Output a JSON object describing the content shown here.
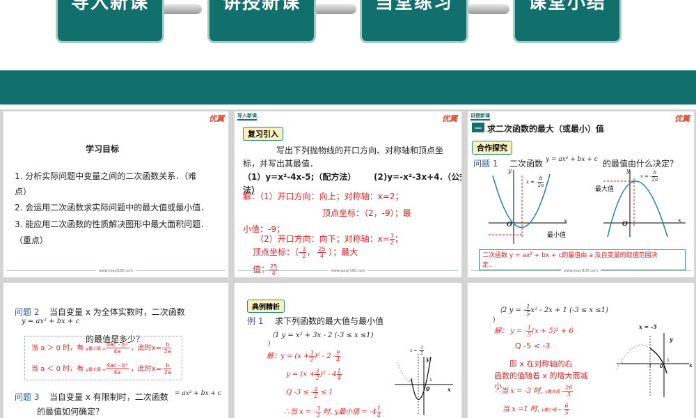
{
  "nav_tabs": [
    "导入新课",
    "讲授新课",
    "当堂练习",
    "课堂小结"
  ],
  "brand": "优翼",
  "website": "www.youyi100.com",
  "colors": {
    "primary": "#12706c",
    "red": "#e02020",
    "blue": "#2b55a4"
  },
  "panel1": {
    "heading": "学习目标",
    "goals": [
      "1. 分析实际问题中变量之间的二次函数关系．（难",
      "点）",
      "2. 会运用二次函数求实际问题中的最大值或最小值．",
      "3. 能应用二次函数的性质解决图形中最大面积问题．",
      "（重点）"
    ]
  },
  "panel2": {
    "header": "导入新课",
    "tag": "复习引入",
    "prompt1": "写出下列抛物线的开口方向、对称轴和顶点坐",
    "prompt2": "标，并写出其最值．",
    "q1": "（1）y=x²-4x-5;（配方法）",
    "q2": "(2)y=-x²-3x+4.（公式",
    "q2b": "法）",
    "a1": "解：（1）开口方向：向上；对称轴：x=2；",
    "a2": "顶点坐标：（2，-9）；最",
    "a3": "小值：-9；",
    "a4": "（2）开口方向：向下；对称轴：x=",
    "a4_num": "3",
    "a4_den": "2",
    "a4_tail": "；",
    "a5": "顶点坐标：（-",
    "a5_num1": "3",
    "a5_den1": "2",
    "a5_sep": "，",
    "a5_num2": "25",
    "a5_den2": "4",
    "a5_tail": "）；最大",
    "a6": "值：",
    "a6_num": "25",
    "a6_den": "4"
  },
  "panel3": {
    "header": "讲授新课",
    "section_num": "一",
    "title": "求二次函数的最大（或最小）值",
    "tag": "合作探究",
    "question_label": "问题 1",
    "question": "二次函数",
    "formula": "y = ax² + bx + c",
    "question_tail": "的最值由什么决定？",
    "axis_x": "x",
    "axis_y": "y",
    "origin": "O",
    "sym_left": "x = -",
    "sym_b": "b",
    "sym_2a": "2a",
    "label_min": "最小值",
    "label_max": "最大值",
    "conclusion1": "二次函数 y = ax² + bx + c的最值由 a 及自变量的取值范围决",
    "conclusion2": "定．"
  },
  "panel4": {
    "q2_label": "问题 2",
    "q2": "当自变量 x 为全体实数时，二次函数",
    "q2_formula": "y = ax² + bx + c",
    "q2_tail": "的最值是多少？",
    "case1": "当 a ＞ 0 时，有",
    "case1_sub": "y最小值 =",
    "case1_num": "4ac - b²",
    "case1_den": "4a",
    "case1_tail": "，此时x=-",
    "case1_b": "b",
    "case1_2a": "2a",
    "case2": "当 a ＜ 0 时，有",
    "case2_sub": "y最大值 =",
    "case2_num": "4ac - b²",
    "case2_den": "4a",
    "case2_tail": "，此时x=-",
    "case2_b": "b",
    "case2_2a": "2a",
    "q3_label": "问题 3",
    "q3": "当自变量 x 有限制时，二次函数",
    "q3_formula": "= ax² + bx + c",
    "q3_tail": "的最值如何确定？"
  },
  "panel5": {
    "tag": "典例精析",
    "ex_label": "例 1",
    "ex": "求下列函数的最大值与最小值",
    "item1": "（1 y = x² + 3x - 2 (-3 ≤ x ≤1)",
    "item1b": "）",
    "s1": "解：y = (x +",
    "s1b": ")² - 2 -",
    "s2": "y = (x +",
    "s2b": ")² - 4",
    "s3": "Q -3 ≤ -",
    "s3b": "≤ 1",
    "s4": "∴当 x = -",
    "s4b": "时, y最小值 = -4",
    "f_3": "3",
    "f_2": "2",
    "f_9": "9",
    "f_4": "4",
    "f_1": "1",
    "g_sym": "x = -",
    "g_sym_num": "3",
    "g_sym_den": "2",
    "g_y": "y",
    "g_x": "x",
    "g_o": "0",
    "g_m3": "-3",
    "g_1": "1"
  },
  "panel6": {
    "item2a": "（2",
    "item2b": "）",
    "item2": "y = -",
    "item2_frac_n": "1",
    "item2_frac_d": "5",
    "item2_tail": "x² - 2x + 1 (-3 ≤ x ≤1)",
    "s1": "解：  y = -",
    "s1_n": "1",
    "s1_d": "5",
    "s1_tail": "(x + 5)² + 6",
    "s2": "Q -5 < -3",
    "s3": "即 x 在对称轴的右",
    "s4": "函数的值随着 x 的增大而减",
    "s5": "小",
    "s6": "∴当 x = -3  时,",
    "s6_sub": "y最大值 =",
    "s6_n": "26",
    "s6_d": "5",
    "s7": "当 x =1  时,",
    "s7_sub": "y最小值 = -",
    "s7_n": "6",
    "s7_d": "5",
    "g_sym": "x = -5",
    "g_y": "y",
    "g_x": "x",
    "g_o": "0",
    "g_m3": "-3",
    "g_1": "1"
  }
}
